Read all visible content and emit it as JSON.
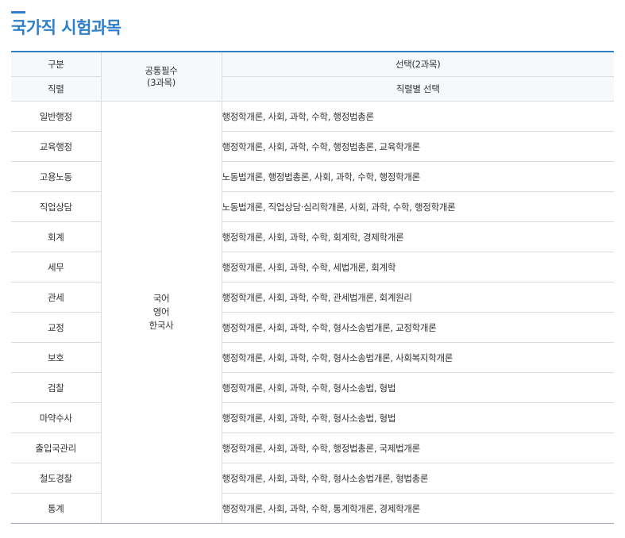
{
  "page_title": "국가직 시험과목",
  "header": {
    "category": "구분",
    "job_series": "직렬",
    "common_required": "공통필수",
    "common_count": "(3과목)",
    "elective": "선택(2과목)",
    "elective_by_series": "직렬별 선택"
  },
  "common_subjects": [
    "국어",
    "영어",
    "한국사"
  ],
  "rows": [
    {
      "job": "일반행정",
      "subjects": "행정학개론, 사회, 과학, 수학, 행정법총론"
    },
    {
      "job": "교육행정",
      "subjects": "행정학개론, 사회, 과학, 수학, 행정법총론, 교육학개론"
    },
    {
      "job": "고용노동",
      "subjects": "노동법개론, 행정법총론, 사회, 과학, 수학, 행정학개론"
    },
    {
      "job": "직업상담",
      "subjects": "노동법개론, 직업상담·심리학개론, 사회, 과학, 수학, 행정학개론"
    },
    {
      "job": "회계",
      "subjects": "행정학개론, 사회, 과학, 수학, 회계학, 경제학개론"
    },
    {
      "job": "세무",
      "subjects": "행정학개론, 사회, 과학, 수학, 세법개론, 회계학"
    },
    {
      "job": "관세",
      "subjects": "행정학개론, 사회, 과학, 수학, 관세법개론, 회계원리"
    },
    {
      "job": "교정",
      "subjects": "행정학개론, 사회, 과학, 수학, 형사소송법개론, 교정학개론"
    },
    {
      "job": "보호",
      "subjects": "행정학개론, 사회, 과학, 수학, 형사소송법개론, 사회복지학개론"
    },
    {
      "job": "검찰",
      "subjects": "행정학개론, 사회, 과학, 수학, 형사소송법, 형법"
    },
    {
      "job": "마약수사",
      "subjects": "행정학개론, 사회, 과학, 수학, 형사소송법, 형법"
    },
    {
      "job": "출입국관리",
      "subjects": "행정학개론, 사회, 과학, 수학, 행정법총론, 국제법개론"
    },
    {
      "job": "철도경찰",
      "subjects": "행정학개론, 사회, 과학, 수학, 형사소송법개론, 형법총론"
    },
    {
      "job": "통계",
      "subjects": "행정학개론, 사회, 과학, 수학, 통계학개론, 경제학개론"
    }
  ],
  "colors": {
    "accent": "#2f7fc9",
    "header_bg": "#f6f8fb",
    "border": "#d9dde3"
  }
}
